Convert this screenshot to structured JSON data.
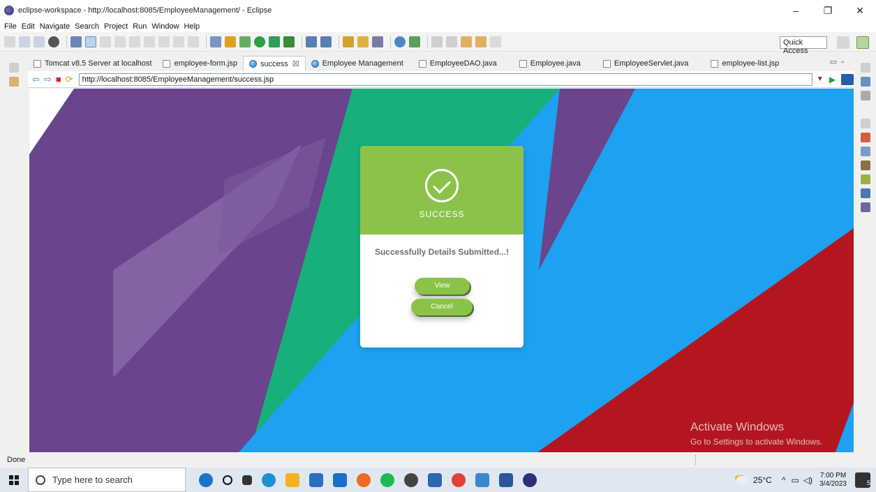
{
  "window": {
    "title": "eclipse-workspace - http://localhost:8085/EmployeeManagement/ - Eclipse",
    "controls": {
      "minimize": "–",
      "maximize": "❐",
      "close": "✕"
    }
  },
  "menu": [
    "File",
    "Edit",
    "Navigate",
    "Search",
    "Project",
    "Run",
    "Window",
    "Help"
  ],
  "toolbar": {
    "quick_access": "Quick Access"
  },
  "tabs": [
    {
      "label": "Tomcat v8.5 Server at localhost",
      "icon": "server-icon"
    },
    {
      "label": "employee-form.jsp",
      "icon": "file-icon"
    },
    {
      "label": "success",
      "icon": "globe-icon",
      "active": true,
      "close": "☒"
    },
    {
      "label": "Employee Management",
      "icon": "globe-icon"
    },
    {
      "label": "EmployeeDAO.java",
      "icon": "java-file-icon"
    },
    {
      "label": "Employee.java",
      "icon": "java-file-icon"
    },
    {
      "label": "EmployeeServlet.java",
      "icon": "java-file-icon"
    },
    {
      "label": "employee-list.jsp",
      "icon": "file-icon"
    }
  ],
  "browser": {
    "url": "http://localhost:8085/EmployeeManagement/success.jsp",
    "back": "⇦",
    "forward": "⇨",
    "stop": "■",
    "refresh": "⟳",
    "go": "▶"
  },
  "card": {
    "heading": "SUCCESS",
    "message": "Successfully Details Submitted...!",
    "view_label": "View",
    "cancel_label": "Cancel"
  },
  "watermark": {
    "line1": "Activate Windows",
    "line2": "Go to Settings to activate Windows."
  },
  "status": {
    "text": "Done"
  },
  "taskbar": {
    "search_placeholder": "Type here to search",
    "temperature": "25°C",
    "time": "7:00 PM",
    "date": "3/4/2023",
    "notifications": "5"
  },
  "colors": {
    "card_green": "#8bc34a",
    "bg_purple": "#6a448c",
    "bg_green": "#17b07a",
    "bg_blue": "#1da1f0",
    "bg_red": "#b3161f"
  }
}
